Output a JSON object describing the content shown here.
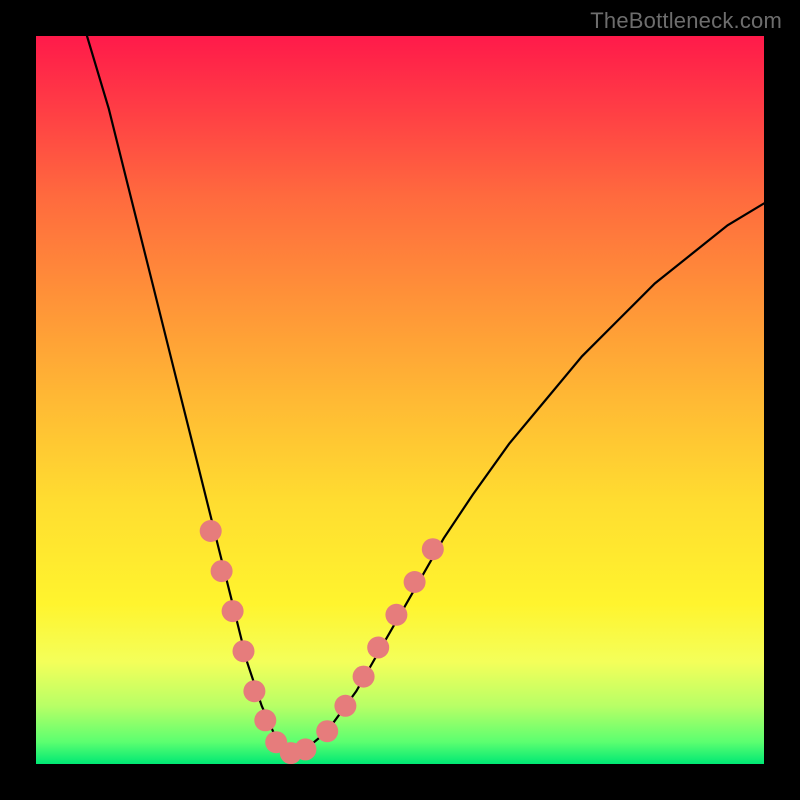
{
  "attribution": "TheBottleneck.com",
  "chart_data": {
    "type": "line",
    "title": "",
    "xlabel": "",
    "ylabel": "",
    "xlim": [
      0,
      100
    ],
    "ylim": [
      0,
      100
    ],
    "curve": {
      "name": "bottleneck-curve",
      "x": [
        7,
        10,
        13,
        16,
        19,
        22,
        25,
        27,
        29,
        31,
        33,
        35,
        37,
        40,
        44,
        48,
        52,
        56,
        60,
        65,
        70,
        75,
        80,
        85,
        90,
        95,
        100
      ],
      "y": [
        100,
        90,
        78,
        66,
        54,
        42,
        30,
        22,
        14,
        8,
        3.5,
        1.5,
        2,
        4.5,
        10,
        17,
        24,
        31,
        37,
        44,
        50,
        56,
        61,
        66,
        70,
        74,
        77
      ]
    },
    "dots": {
      "name": "highlight-points",
      "color": "#e67c7c",
      "radius_px": 11,
      "points": [
        {
          "x": 24.0,
          "y": 32.0
        },
        {
          "x": 25.5,
          "y": 26.5
        },
        {
          "x": 27.0,
          "y": 21.0
        },
        {
          "x": 28.5,
          "y": 15.5
        },
        {
          "x": 30.0,
          "y": 10.0
        },
        {
          "x": 31.5,
          "y": 6.0
        },
        {
          "x": 33.0,
          "y": 3.0
        },
        {
          "x": 35.0,
          "y": 1.5
        },
        {
          "x": 37.0,
          "y": 2.0
        },
        {
          "x": 40.0,
          "y": 4.5
        },
        {
          "x": 42.5,
          "y": 8.0
        },
        {
          "x": 45.0,
          "y": 12.0
        },
        {
          "x": 47.0,
          "y": 16.0
        },
        {
          "x": 49.5,
          "y": 20.5
        },
        {
          "x": 52.0,
          "y": 25.0
        },
        {
          "x": 54.5,
          "y": 29.5
        }
      ]
    }
  }
}
